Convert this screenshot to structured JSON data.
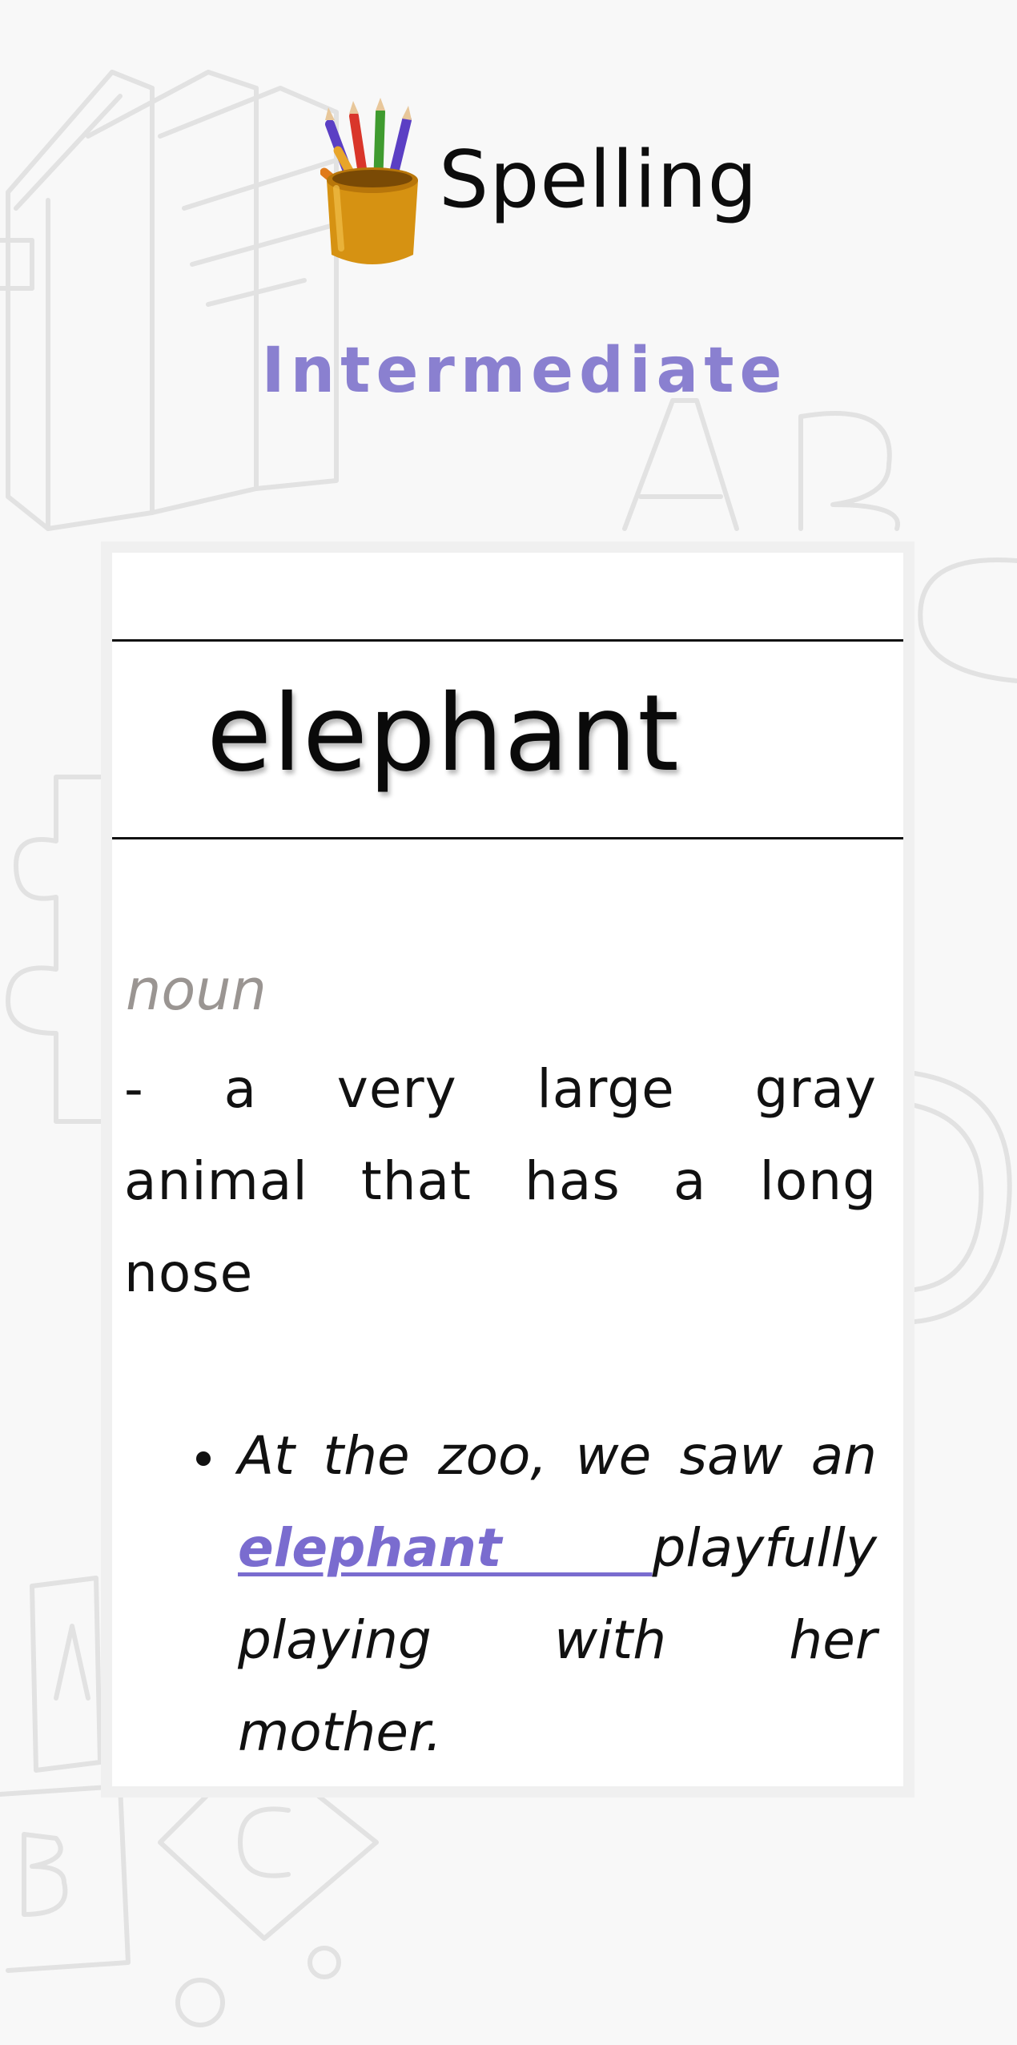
{
  "app": {
    "title": "Spelling",
    "level": "Intermediate",
    "icon": "pencil-cup-icon"
  },
  "card": {
    "word": "elephant",
    "part_of_speech": "noun",
    "definition": "- a very large gray animal that has a long nose",
    "example": {
      "before": "At the zoo, we saw an ",
      "highlight": "elephant ",
      "after": "playfully playing with her mother."
    }
  },
  "colors": {
    "background": "#f8f8f8",
    "accent": "#8a80d0",
    "highlight": "#7a6ccf",
    "part_of_speech": "#9a9592",
    "card": "#ffffff"
  }
}
